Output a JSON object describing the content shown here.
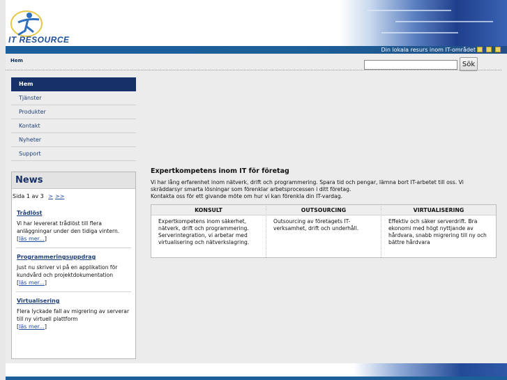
{
  "header": {
    "logo_text": "IT RESOURCE",
    "tagline": "Din lokala resurs inom IT-området"
  },
  "breadcrumb": "Hem",
  "search": {
    "value": "",
    "button_label": "Sök"
  },
  "nav": {
    "items": [
      {
        "label": "Hem",
        "active": true
      },
      {
        "label": "Tjänster"
      },
      {
        "label": "Produkter"
      },
      {
        "label": "Kontakt"
      },
      {
        "label": "Nyheter"
      },
      {
        "label": "Support"
      }
    ]
  },
  "news": {
    "title": "News",
    "pager_text": "Sida 1 av 3",
    "pager_next": ">",
    "pager_last": ">>",
    "items": [
      {
        "headline": "Trådlöst",
        "body": "Vi har levererat trådlöst till flera anläggningar under den tidiga vintern.",
        "more": "läs mer..."
      },
      {
        "headline": "Programmeringsuppdrag",
        "body": "Just nu skriver vi på en applikation för kundvård och projektdokumentation",
        "more": "läs mer..."
      },
      {
        "headline": "Virtualisering",
        "body": "Flera lyckade fall av migrering av serverar till ny virtuell plattform",
        "more": "läs mer..."
      }
    ]
  },
  "main": {
    "title": "Expertkompetens inom IT för företag",
    "intro": "Vi har lång erfarenhet inom nätverk, drift och programmering. Spara tid och pengar, lämna bort IT-arbetet till oss. Vi skräddarsyr smarta lösningar som förenklar arbetsprocessen i ditt företag.",
    "contact": "Kontakta oss för ett givande möte om hur vi kan förenkla din IT-vardag.",
    "services": [
      {
        "title": "KONSULT",
        "body": "Expertkompetens inom säkerhet, nätverk, drift och programmering. Serverintegration, vi arbetar med virtualisering och nätverkslagring."
      },
      {
        "title": "OUTSOURCING",
        "body": "Outsourcing av företagets IT-verksamhet, drift och underhåll."
      },
      {
        "title": "VIRTUALISERING",
        "body": "Effektiv och säker serverdrift. Bra ekonomi med högt nyttjande av hårdvara, snabb migrering till ny och bättre hårdvara"
      }
    ]
  },
  "colors": {
    "nav_active": "#16306a",
    "header_bar": "#1c5f99",
    "link": "#1f4aa0"
  }
}
